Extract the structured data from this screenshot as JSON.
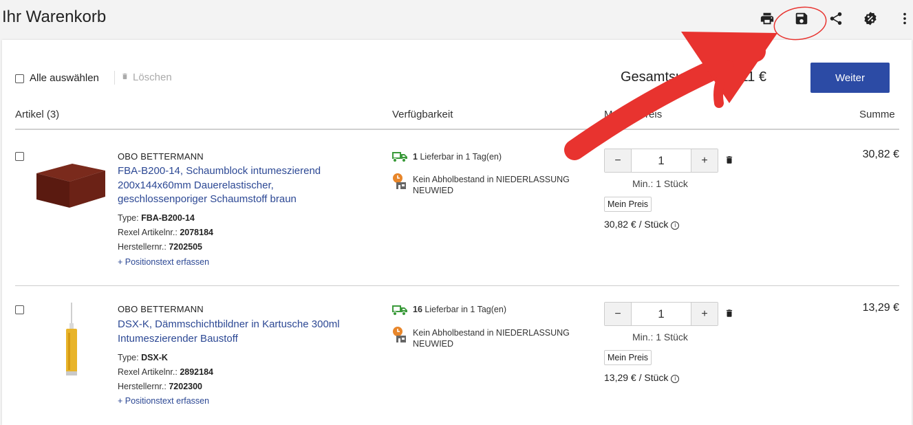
{
  "header": {
    "title": "Ihr Warenkorb",
    "icons": [
      "print-icon",
      "save-icon",
      "share-icon",
      "settings-badge-icon",
      "more-vertical-icon"
    ]
  },
  "toolbar": {
    "select_all_label": "Alle auswählen",
    "delete_label": "Löschen",
    "total_label": "Gesamtsumme: 44,11 €",
    "next_label": "Weiter"
  },
  "table": {
    "columns": [
      "Artikel (3)",
      "Verfügbarkeit",
      "Menge/Preis",
      "Summe"
    ]
  },
  "items": [
    {
      "brand": "OBO BETTERMANN",
      "name": "FBA-B200-14, Schaumblock intumeszierend 200x144x60mm Dauerelastischer, geschlossenporiger Schaumstoff braun",
      "type_label": "Type:",
      "type_value": "FBA-B200-14",
      "rexel_label": "Rexel Artikelnr.:",
      "rexel_value": "2078184",
      "mfr_label": "Herstellernr.:",
      "mfr_value": "7202505",
      "add_position_text": "+  Positionstext erfassen",
      "stock_qty": "1",
      "stock_text": "Lieferbar in 1 Tag(en)",
      "pickup_text": "Kein Abholbestand in NIEDERLASSUNG NEUWIED",
      "quantity": "1",
      "min_qty": "Min.: 1 Stück",
      "my_price_label": "Mein Preis",
      "unit_price": "30,82 € / Stück",
      "sum": "30,82 €"
    },
    {
      "brand": "OBO BETTERMANN",
      "name": "DSX-K, Dämmschichtbildner in Kartusche 300ml Intumeszierender Baustoff",
      "type_label": "Type:",
      "type_value": "DSX-K",
      "rexel_label": "Rexel Artikelnr.:",
      "rexel_value": "2892184",
      "mfr_label": "Herstellernr.:",
      "mfr_value": "7202300",
      "add_position_text": "+  Positionstext erfassen",
      "stock_qty": "16",
      "stock_text": "Lieferbar in 1 Tag(en)",
      "pickup_text": "Kein Abholbestand in NIEDERLASSUNG NEUWIED",
      "quantity": "1",
      "min_qty": "Min.: 1 Stück",
      "my_price_label": "Mein Preis",
      "unit_price": "13,29 € / Stück",
      "sum": "13,29 €"
    }
  ],
  "colors": {
    "brand_blue": "#2c4ba5",
    "link_blue": "#2c4894",
    "truck_green": "#3a9a3a",
    "clock_orange": "#e8862a",
    "annotation_red": "#e8332f"
  }
}
